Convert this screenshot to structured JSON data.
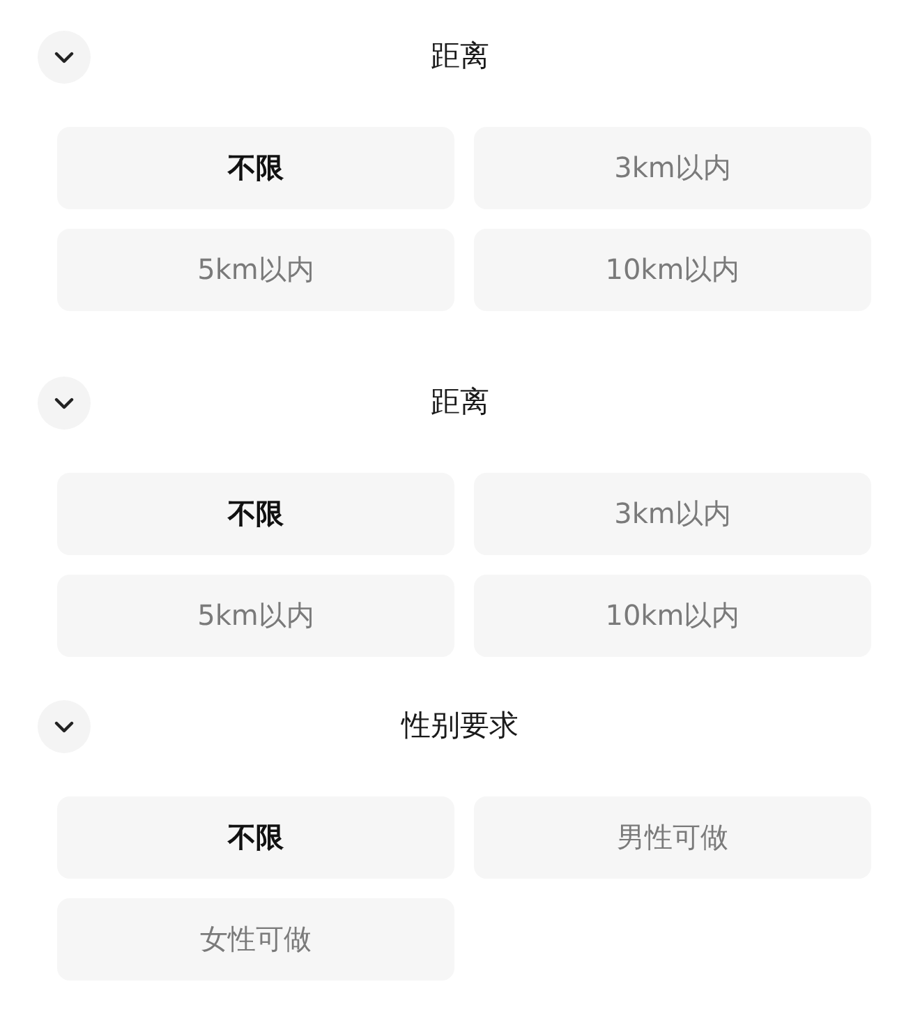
{
  "sections": [
    {
      "title": "距离",
      "options": [
        {
          "label": "不限",
          "selected": true
        },
        {
          "label": "3km以内",
          "selected": false
        },
        {
          "label": "5km以内",
          "selected": false
        },
        {
          "label": "10km以内",
          "selected": false
        }
      ]
    },
    {
      "title": "距离",
      "options": [
        {
          "label": "不限",
          "selected": true
        },
        {
          "label": "3km以内",
          "selected": false
        },
        {
          "label": "5km以内",
          "selected": false
        },
        {
          "label": "10km以内",
          "selected": false
        }
      ]
    },
    {
      "title": "性别要求",
      "options": [
        {
          "label": "不限",
          "selected": true
        },
        {
          "label": "男性可做",
          "selected": false
        },
        {
          "label": "女性可做",
          "selected": false
        }
      ]
    }
  ]
}
